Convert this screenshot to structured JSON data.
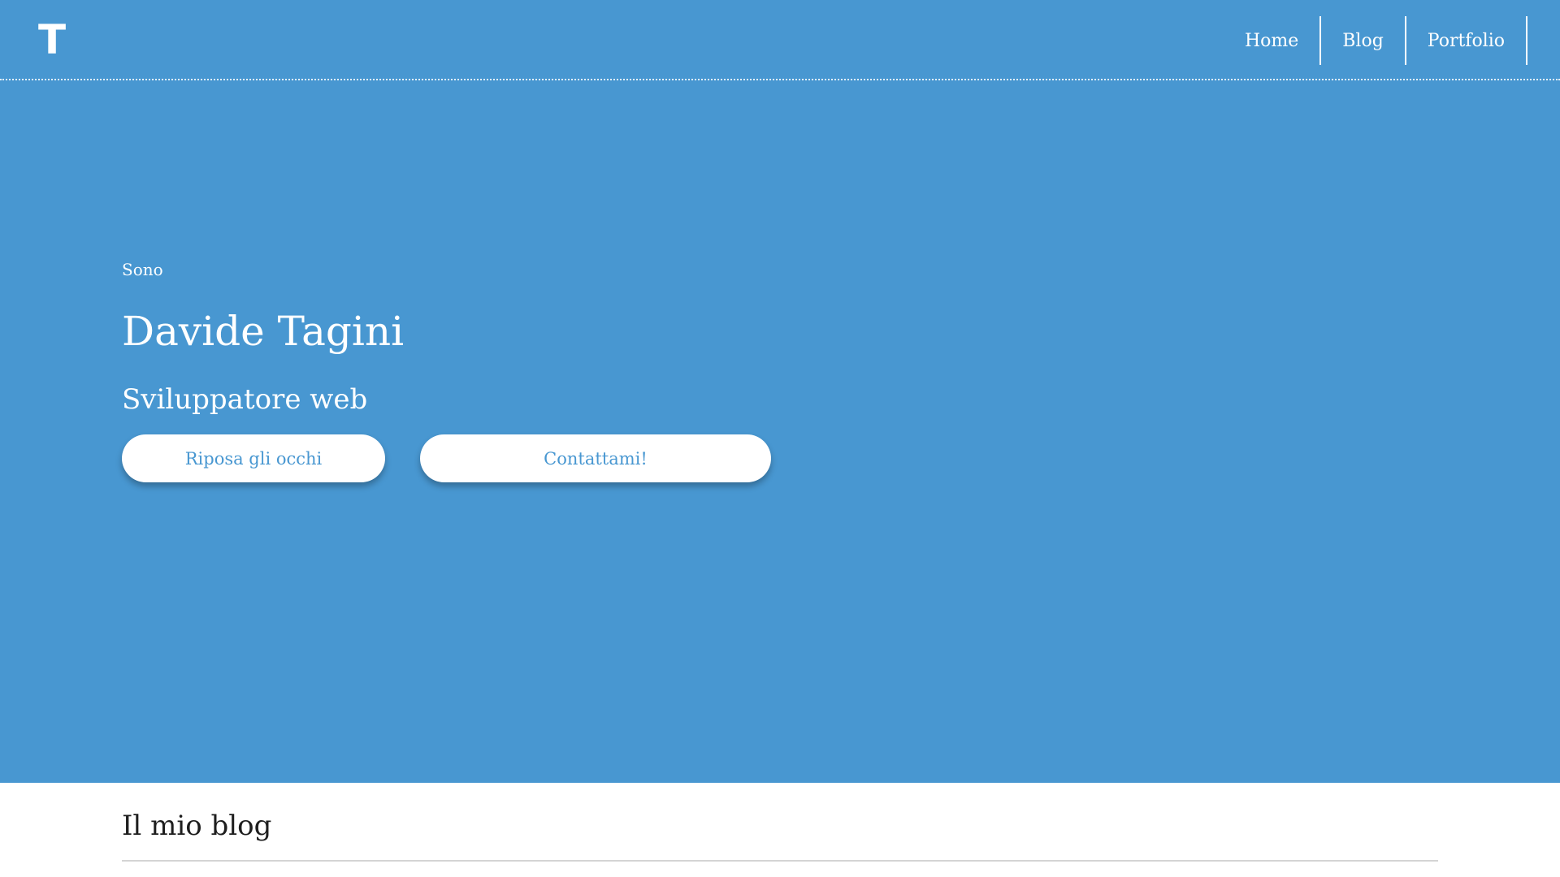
{
  "header": {
    "logo_text": "T",
    "nav": [
      {
        "label": "Home"
      },
      {
        "label": "Blog"
      },
      {
        "label": "Portfolio"
      }
    ]
  },
  "hero": {
    "intro": "Sono",
    "name": "Davide Tagini",
    "role": "Sviluppatore web",
    "buttons": {
      "rest_label": "Riposa gli occhi",
      "contact_label": "Contattami!"
    }
  },
  "blog": {
    "title": "Il mio blog"
  },
  "colors": {
    "accent": "#4897d1",
    "text_on_accent": "#ffffff",
    "heading": "#1e1e1e"
  }
}
